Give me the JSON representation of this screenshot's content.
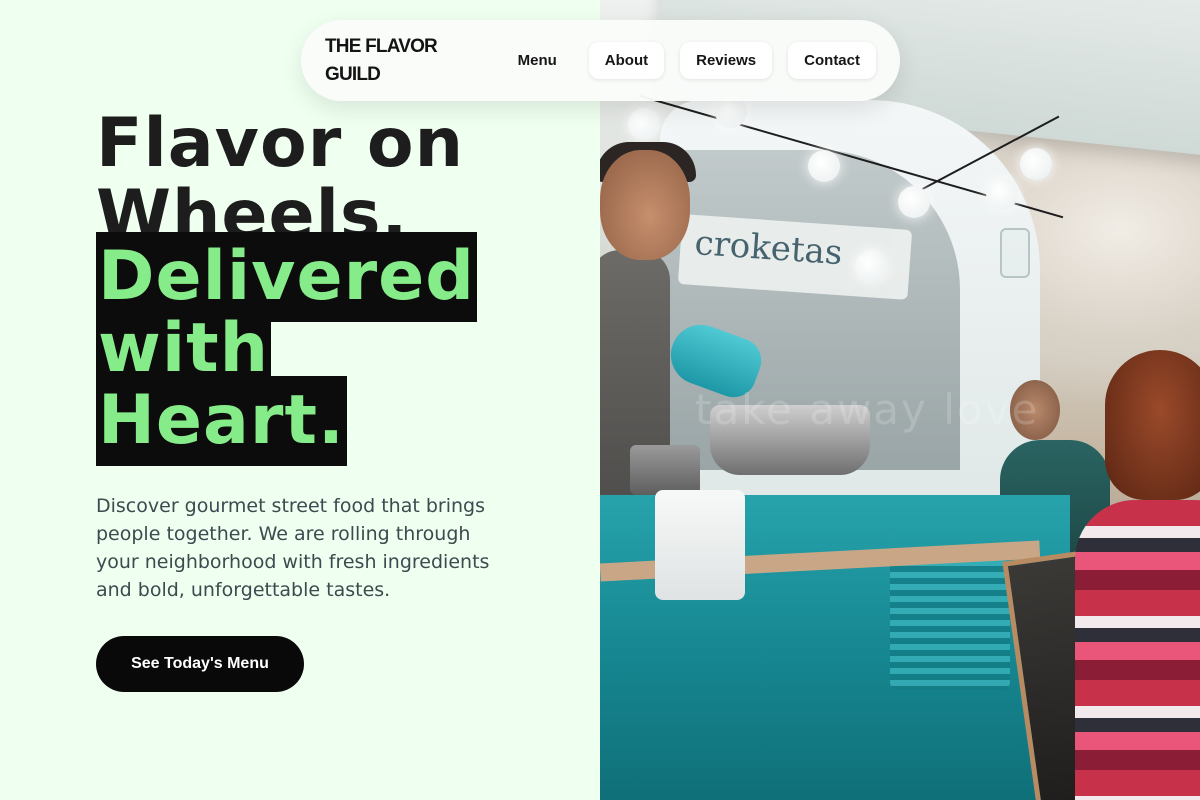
{
  "nav": {
    "brand": "THE FLAVOR GUILD",
    "links": [
      "Menu",
      "About",
      "Reviews",
      "Contact"
    ]
  },
  "hero": {
    "title_line1": "Flavor on",
    "title_line2": "Wheels,",
    "highlight_line1": "Delivered",
    "highlight_line2": "with",
    "highlight_line3": "Heart.",
    "description": "Discover gourmet street food that brings people together. We are rolling through your neighborhood with fresh ingredients and bold, unforgettable tastes.",
    "cta_label": "See Today's Menu"
  },
  "photo": {
    "sign_text": "croketas",
    "watermark_text": "take away love"
  },
  "colors": {
    "background": "#effff0",
    "highlight_bg": "#0c0c0c",
    "highlight_text": "#86ec8a",
    "cta_bg": "#090909"
  }
}
